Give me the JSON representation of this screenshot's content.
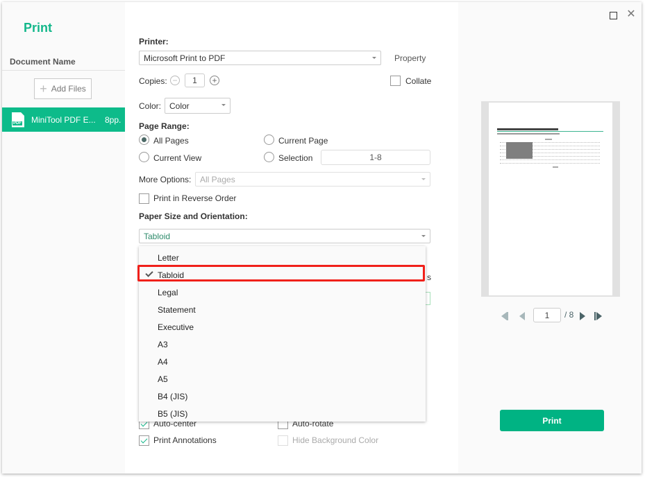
{
  "sidebar": {
    "title": "Print",
    "document_header": "Document Name",
    "add_files_label": "Add Files",
    "documents": [
      {
        "icon": "pdf-file-icon",
        "name": "MiniTool PDF E...",
        "pages": "8pp."
      }
    ]
  },
  "printer": {
    "label": "Printer:",
    "selected": "Microsoft Print to PDF",
    "property_label": "Property"
  },
  "copies": {
    "label": "Copies:",
    "value": "1",
    "collate_label": "Collate",
    "collate_checked": false
  },
  "color": {
    "label": "Color:",
    "selected": "Color"
  },
  "page_range": {
    "label": "Page Range:",
    "options": {
      "all_pages": "All Pages",
      "current_page": "Current Page",
      "current_view": "Current View",
      "selection": "Selection"
    },
    "selected": "All Pages",
    "selection_value": "1-8"
  },
  "more_options": {
    "label": "More Options:",
    "selected": "All Pages"
  },
  "reverse_order": {
    "label": "Print in Reverse Order",
    "checked": false
  },
  "paper": {
    "label": "Paper Size and Orientation:",
    "selected": "Tabloid",
    "options": [
      "Letter",
      "Tabloid",
      "Legal",
      "Statement",
      "Executive",
      "A3",
      "A4",
      "A5",
      "B4 (JIS)",
      "B5 (JIS)"
    ],
    "obscured_fragment": "s"
  },
  "options": {
    "auto_center": {
      "label": "Auto-center",
      "checked": true
    },
    "auto_rotate": {
      "label": "Auto-rotate",
      "checked": false
    },
    "print_annotations": {
      "label": "Print Annotations",
      "checked": true
    },
    "hide_background": {
      "label": "Hide Background Color",
      "checked": false,
      "disabled": true
    }
  },
  "preview": {
    "current_page": "1",
    "total_pages": "/ 8"
  },
  "actions": {
    "print_label": "Print"
  },
  "window_controls": {
    "close_glyph": "✕"
  },
  "colors": {
    "accent": "#00b383",
    "highlight_border": "#f0201a"
  }
}
